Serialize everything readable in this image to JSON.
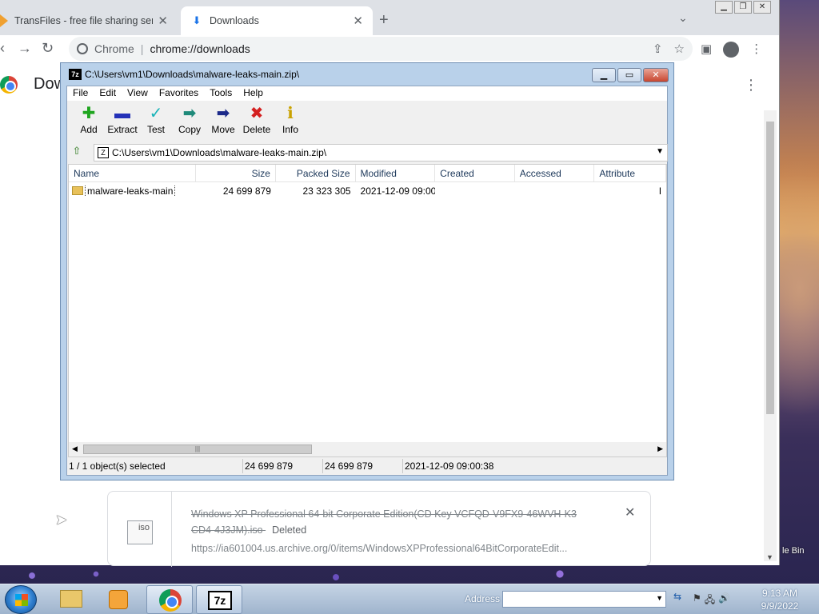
{
  "chrome": {
    "tabs": [
      {
        "label": "TransFiles - free file sharing servi",
        "active": false
      },
      {
        "label": "Downloads",
        "active": true
      }
    ],
    "omnibox": {
      "site": "Chrome",
      "url": "chrome://downloads"
    },
    "page_title": "Dow",
    "download": {
      "filename": "Windows XP Professional 64-bit Corporate Edition(CD Key VCFQD-V9FX9-46WVH-K3 CD4-4J3JM).iso",
      "status": "Deleted",
      "url": "https://ia601004.us.archive.org/0/items/WindowsXPProfessional64BitCorporateEdit...",
      "file_icon_label": "iso"
    }
  },
  "sevenzip": {
    "title": "C:\\Users\\vm1\\Downloads\\malware-leaks-main.zip\\",
    "app_icon": "7z",
    "menu": [
      "File",
      "Edit",
      "View",
      "Favorites",
      "Tools",
      "Help"
    ],
    "toolbar": [
      {
        "label": "Add",
        "icon": "plus-icon"
      },
      {
        "label": "Extract",
        "icon": "minus-icon"
      },
      {
        "label": "Test",
        "icon": "check-icon"
      },
      {
        "label": "Copy",
        "icon": "copy-arrow-icon"
      },
      {
        "label": "Move",
        "icon": "move-arrow-icon"
      },
      {
        "label": "Delete",
        "icon": "x-icon"
      },
      {
        "label": "Info",
        "icon": "info-icon"
      }
    ],
    "path": "C:\\Users\\vm1\\Downloads\\malware-leaks-main.zip\\",
    "columns": [
      "Name",
      "Size",
      "Packed Size",
      "Modified",
      "Created",
      "Accessed",
      "Attribute"
    ],
    "rows": [
      {
        "name": "malware-leaks-main",
        "size": "24 699 879",
        "packed": "23 323 305",
        "modified": "2021-12-09 09:00",
        "created": "",
        "accessed": "",
        "attr": "I"
      }
    ],
    "status": {
      "selected": "1 / 1 object(s) selected",
      "size": "24 699 879",
      "packed": "24 699 879",
      "modified": "2021-12-09 09:00:38"
    }
  },
  "desktop": {
    "recycle_label": "le Bin"
  },
  "taskbar": {
    "address_label": "Address",
    "address_value": "",
    "clock_time": "9:13 AM",
    "clock_date": "9/9/2022"
  }
}
